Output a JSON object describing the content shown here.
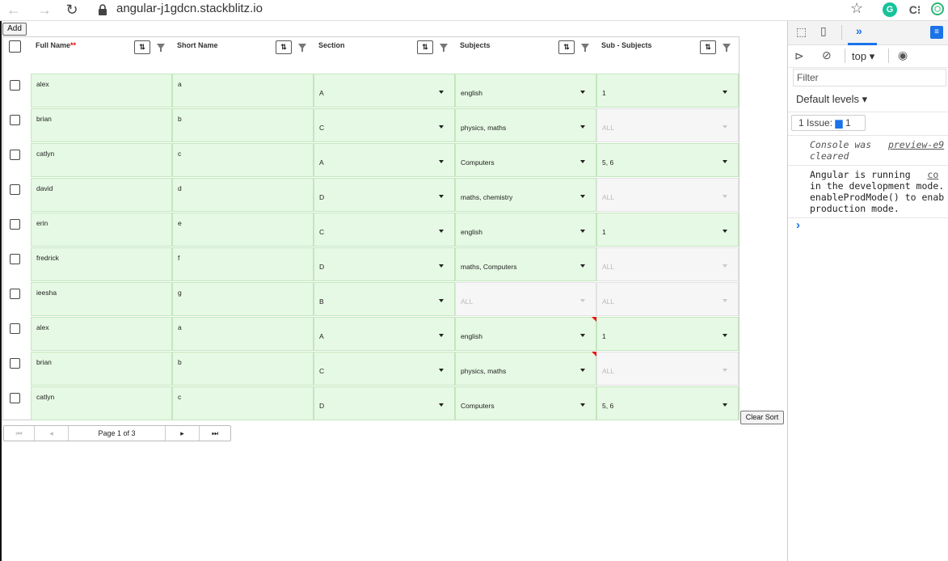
{
  "browser": {
    "url": "angular-j1gdcn.stackblitz.io"
  },
  "toolbar": {
    "add_label": "Add",
    "clear_sort_label": "Clear Sort"
  },
  "grid": {
    "headers": [
      "Full Name",
      "Short Name",
      "Section",
      "Subjects",
      "Sub - Subjects"
    ],
    "required_marker": "**",
    "sort_symbol": "⇅",
    "rows": [
      {
        "full": "alex",
        "short": "a",
        "section": "A",
        "subjects": "english",
        "sub": "1",
        "subjects_disabled": false,
        "sub_disabled": false,
        "flag": false
      },
      {
        "full": "brian",
        "short": "b",
        "section": "C",
        "subjects": "physics, maths",
        "sub": "ALL",
        "subjects_disabled": false,
        "sub_disabled": true,
        "flag": false
      },
      {
        "full": "catlyn",
        "short": "c",
        "section": "A",
        "subjects": "Computers",
        "sub": "5, 6",
        "subjects_disabled": false,
        "sub_disabled": false,
        "flag": false
      },
      {
        "full": "david",
        "short": "d",
        "section": "D",
        "subjects": "maths, chemistry",
        "sub": "ALL",
        "subjects_disabled": false,
        "sub_disabled": true,
        "flag": false
      },
      {
        "full": "erin",
        "short": "e",
        "section": "C",
        "subjects": "english",
        "sub": "1",
        "subjects_disabled": false,
        "sub_disabled": false,
        "flag": false
      },
      {
        "full": "fredrick",
        "short": "f",
        "section": "D",
        "subjects": "maths, Computers",
        "sub": "ALL",
        "subjects_disabled": false,
        "sub_disabled": true,
        "flag": false
      },
      {
        "full": "ieesha",
        "short": "g",
        "section": "B",
        "subjects": "ALL",
        "sub": "ALL",
        "subjects_disabled": true,
        "sub_disabled": true,
        "flag": false
      },
      {
        "full": "alex",
        "short": "a",
        "section": "A",
        "subjects": "english",
        "sub": "1",
        "subjects_disabled": false,
        "sub_disabled": false,
        "flag": true
      },
      {
        "full": "brian",
        "short": "b",
        "section": "C",
        "subjects": "physics, maths",
        "sub": "ALL",
        "subjects_disabled": false,
        "sub_disabled": true,
        "flag": true
      },
      {
        "full": "catlyn",
        "short": "c",
        "section": "D",
        "subjects": "Computers",
        "sub": "5, 6",
        "subjects_disabled": false,
        "sub_disabled": false,
        "flag": false
      }
    ]
  },
  "pager": {
    "page_label": "Page 1 of 3"
  },
  "devtools": {
    "context": "top",
    "filter_placeholder": "Filter",
    "levels": "Default levels",
    "issues_label": "1 Issue:",
    "issues_count": "1",
    "log1_line1": "Console was",
    "log1_line2": "cleared",
    "log1_link": "preview-e9",
    "log2_line1": "Angular is running",
    "log2_link": "co",
    "log2_line2": "in the development mode.",
    "log2_line3": "enableProdMode() to enab",
    "log2_line4": "production mode.",
    "prompt": "›"
  },
  "colors": {
    "cell_bg": "#e6f9e4",
    "disabled_bg": "#f6f6f6",
    "accent": "#1a73e8"
  }
}
